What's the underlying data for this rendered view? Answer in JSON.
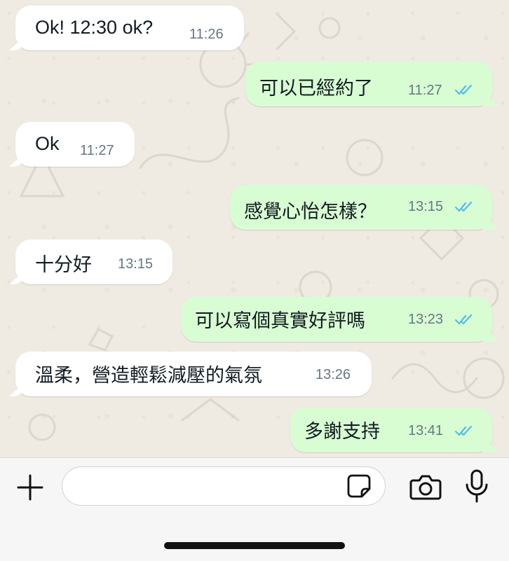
{
  "messages": [
    {
      "direction": "in",
      "text": "Ok! 12:30 ok?",
      "time": "11:26"
    },
    {
      "direction": "out",
      "text": "可以已經約了",
      "time": "11:27",
      "status": "read"
    },
    {
      "direction": "in",
      "text": "Ok",
      "time": "11:27"
    },
    {
      "direction": "out",
      "text": "感覺心怡怎樣？",
      "time": "13:15",
      "status": "read"
    },
    {
      "direction": "in",
      "text": "十分好",
      "time": "13:15"
    },
    {
      "direction": "out",
      "text": "可以寫個真實好評嗎",
      "time": "13:23",
      "status": "read"
    },
    {
      "direction": "in",
      "text": "溫柔，營造輕鬆減壓的氣氛",
      "time": "13:26"
    },
    {
      "direction": "out",
      "text": "多謝支持",
      "time": "13:41",
      "status": "read"
    }
  ],
  "composer": {
    "message_input": {
      "value": "",
      "placeholder": ""
    },
    "icons": [
      "plus-icon",
      "sticker-icon",
      "camera-icon",
      "microphone-icon"
    ]
  },
  "colors": {
    "wallpaper": "#efeae2",
    "incoming_bubble": "#ffffff",
    "outgoing_bubble": "#d9fdd3",
    "read_ticks": "#53bdeb",
    "timestamp": "#667781"
  }
}
